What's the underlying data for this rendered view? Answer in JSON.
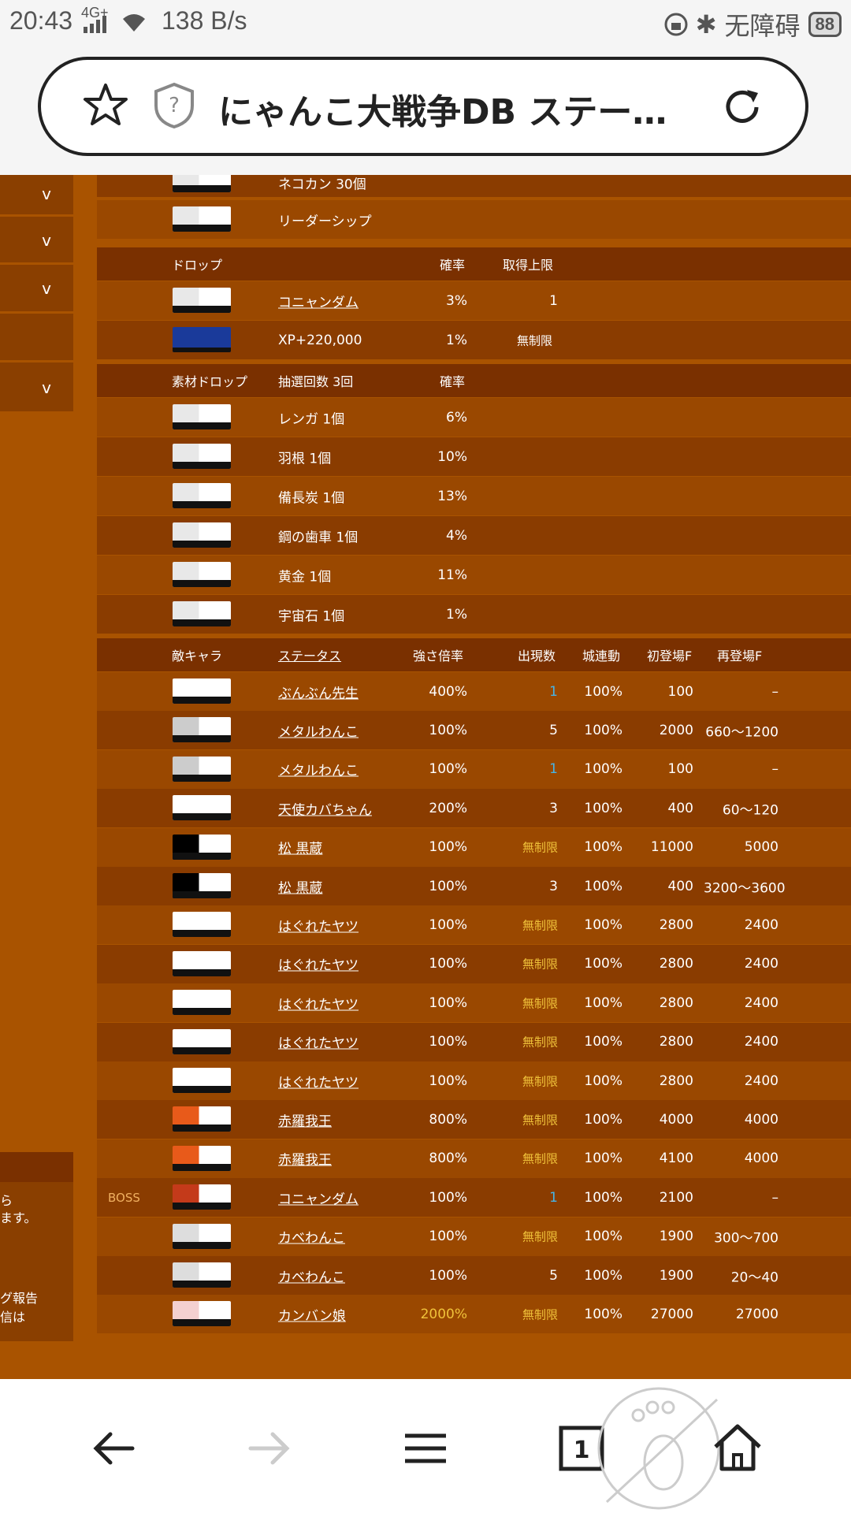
{
  "status_bar": {
    "time": "20:43",
    "network": "4G+",
    "speed": "138 B/s",
    "accessibility": "无障碍",
    "battery": "88"
  },
  "browser": {
    "title": "にゃんこ大戦争DB ステー…"
  },
  "top_rows": [
    {
      "name": "ネコカン 30個"
    },
    {
      "name": "リーダーシップ"
    }
  ],
  "drop": {
    "headers": {
      "label": "ドロップ",
      "rate": "確率",
      "limit": "取得上限"
    },
    "rows": [
      {
        "name": "コニャンダム",
        "rate": "3%",
        "limit": "1"
      },
      {
        "name": "XP+220,000",
        "rate": "1%",
        "limit": "無制限"
      }
    ]
  },
  "material": {
    "headers": {
      "label": "素材ドロップ",
      "draws": "抽選回数 3回",
      "rate": "確率"
    },
    "rows": [
      {
        "name": "レンガ 1個",
        "rate": "6%"
      },
      {
        "name": "羽根 1個",
        "rate": "10%"
      },
      {
        "name": "備長炭 1個",
        "rate": "13%"
      },
      {
        "name": "鋼の歯車 1個",
        "rate": "4%"
      },
      {
        "name": "黄金 1個",
        "rate": "11%"
      },
      {
        "name": "宇宙石 1個",
        "rate": "1%"
      }
    ]
  },
  "enemies": {
    "headers": {
      "label": "敵キャラ",
      "status": "ステータス",
      "mult": "強さ倍率",
      "count": "出現数",
      "castle": "城連動",
      "first": "初登場F",
      "re": "再登場F"
    },
    "rows": [
      {
        "tag": "",
        "name": "ぶんぶん先生",
        "mult": "400%",
        "count": "1",
        "castle": "100%",
        "first": "100",
        "re": "–",
        "icon": "#fff"
      },
      {
        "tag": "",
        "name": "メタルわんこ",
        "mult": "100%",
        "count": "5",
        "castle": "100%",
        "first": "2000",
        "re": "660～1200",
        "icon": "#ccc"
      },
      {
        "tag": "",
        "name": "メタルわんこ",
        "mult": "100%",
        "count": "1",
        "castle": "100%",
        "first": "100",
        "re": "–",
        "icon": "#ccc"
      },
      {
        "tag": "",
        "name": "天使カバちゃん",
        "mult": "200%",
        "count": "3",
        "castle": "100%",
        "first": "400",
        "re": "60～120",
        "icon": "#fff"
      },
      {
        "tag": "",
        "name": "松 黒蔵",
        "mult": "100%",
        "count": "無制限",
        "castle": "100%",
        "first": "11000",
        "re": "5000",
        "icon": "#000"
      },
      {
        "tag": "",
        "name": "松 黒蔵",
        "mult": "100%",
        "count": "3",
        "castle": "100%",
        "first": "400",
        "re": "3200～3600",
        "icon": "#000"
      },
      {
        "tag": "",
        "name": "はぐれたヤツ",
        "mult": "100%",
        "count": "無制限",
        "castle": "100%",
        "first": "2800",
        "re": "2400",
        "icon": "#fff"
      },
      {
        "tag": "",
        "name": "はぐれたヤツ",
        "mult": "100%",
        "count": "無制限",
        "castle": "100%",
        "first": "2800",
        "re": "2400",
        "icon": "#fff"
      },
      {
        "tag": "",
        "name": "はぐれたヤツ",
        "mult": "100%",
        "count": "無制限",
        "castle": "100%",
        "first": "2800",
        "re": "2400",
        "icon": "#fff"
      },
      {
        "tag": "",
        "name": "はぐれたヤツ",
        "mult": "100%",
        "count": "無制限",
        "castle": "100%",
        "first": "2800",
        "re": "2400",
        "icon": "#fff"
      },
      {
        "tag": "",
        "name": "はぐれたヤツ",
        "mult": "100%",
        "count": "無制限",
        "castle": "100%",
        "first": "2800",
        "re": "2400",
        "icon": "#fff"
      },
      {
        "tag": "",
        "name": "赤羅我王",
        "mult": "800%",
        "count": "無制限",
        "castle": "100%",
        "first": "4000",
        "re": "4000",
        "icon": "#e85a1a"
      },
      {
        "tag": "",
        "name": "赤羅我王",
        "mult": "800%",
        "count": "無制限",
        "castle": "100%",
        "first": "4100",
        "re": "4000",
        "icon": "#e85a1a"
      },
      {
        "tag": "BOSS",
        "name": "コニャンダム",
        "mult": "100%",
        "count": "1",
        "castle": "100%",
        "first": "2100",
        "re": "–",
        "icon": "#c43a1a"
      },
      {
        "tag": "",
        "name": "カベわんこ",
        "mult": "100%",
        "count": "無制限",
        "castle": "100%",
        "first": "1900",
        "re": "300～700",
        "icon": "#ddd"
      },
      {
        "tag": "",
        "name": "カベわんこ",
        "mult": "100%",
        "count": "5",
        "castle": "100%",
        "first": "1900",
        "re": "20～40",
        "icon": "#ddd"
      },
      {
        "tag": "",
        "name": "カンバン娘",
        "mult": "2000%",
        "count": "無制限",
        "castle": "100%",
        "first": "27000",
        "re": "27000",
        "icon": "#f4d0d0"
      }
    ]
  },
  "side_note": {
    "line1": "ら",
    "line2": "ます。",
    "line3": "グ報告",
    "line4": "信は"
  },
  "colors": {
    "count_link": "#46b4e6",
    "unlimited": "#f0c23a",
    "header_bg": "#7a3000"
  }
}
